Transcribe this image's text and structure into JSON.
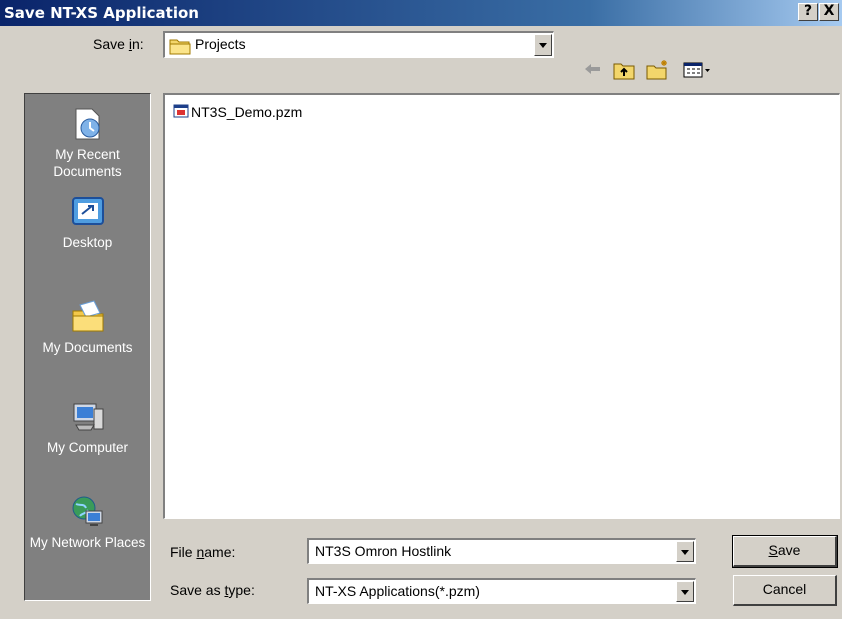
{
  "title": "Save NT-XS Application",
  "title_buttons": {
    "help": "?",
    "close": "X"
  },
  "save_in": {
    "label_pre": "Save ",
    "label_key": "i",
    "label_post": "n:",
    "value": "Projects"
  },
  "toolbar": {
    "icons": [
      "back-icon",
      "up-folder-icon",
      "new-folder-icon",
      "views-menu-icon"
    ]
  },
  "places": [
    {
      "label": "My Recent Documents",
      "icon": "recent-documents-icon"
    },
    {
      "label": "Desktop",
      "icon": "desktop-icon"
    },
    {
      "label": "My Documents",
      "icon": "my-documents-icon"
    },
    {
      "label": "My Computer",
      "icon": "my-computer-icon"
    },
    {
      "label": "My Network Places",
      "icon": "network-places-icon"
    }
  ],
  "files": [
    {
      "name": "NT3S_Demo.pzm",
      "icon": "pzm-file-icon"
    }
  ],
  "file_name": {
    "label_pre": "File ",
    "label_key": "n",
    "label_post": "ame:",
    "value": "NT3S Omron Hostlink"
  },
  "save_type": {
    "label_pre": "Save as ",
    "label_key": "t",
    "label_post": "ype:",
    "value": "NT-XS Applications(*.pzm)"
  },
  "buttons": {
    "save_key": "S",
    "save_rest": "ave",
    "cancel": "Cancel"
  }
}
